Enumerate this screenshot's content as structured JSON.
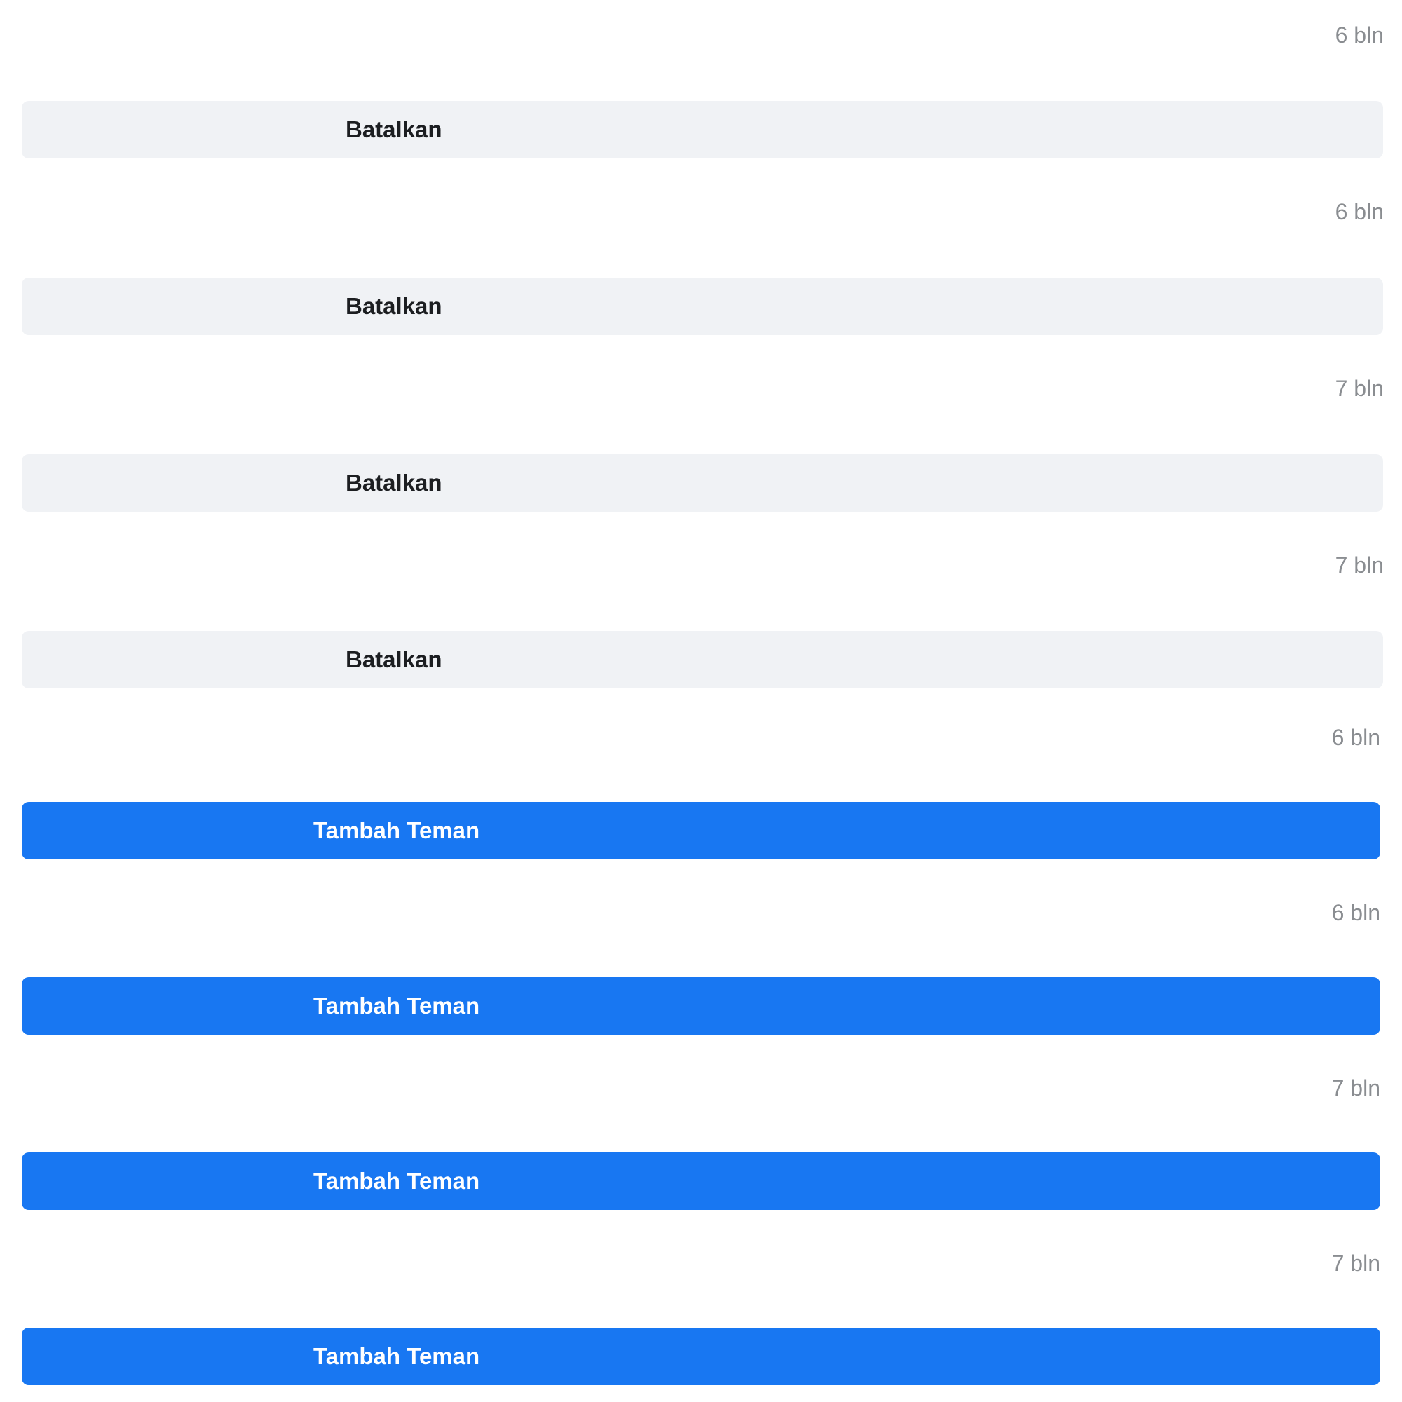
{
  "colors": {
    "cancel_bg": "#f0f2f5",
    "cancel_text": "#1c1e21",
    "add_bg": "#1877f2",
    "add_text": "#ffffff",
    "timestamp_text": "#8a8d91"
  },
  "sent_requests": [
    {
      "time": "6 bln",
      "action_label": "Batalkan"
    },
    {
      "time": "6 bln",
      "action_label": "Batalkan"
    },
    {
      "time": "7 bln",
      "action_label": "Batalkan"
    },
    {
      "time": "7 bln",
      "action_label": "Batalkan"
    }
  ],
  "suggestions": [
    {
      "time": "6 bln",
      "action_label": "Tambah Teman"
    },
    {
      "time": "6 bln",
      "action_label": "Tambah Teman"
    },
    {
      "time": "7 bln",
      "action_label": "Tambah Teman"
    },
    {
      "time": "7 bln",
      "action_label": "Tambah Teman"
    }
  ]
}
